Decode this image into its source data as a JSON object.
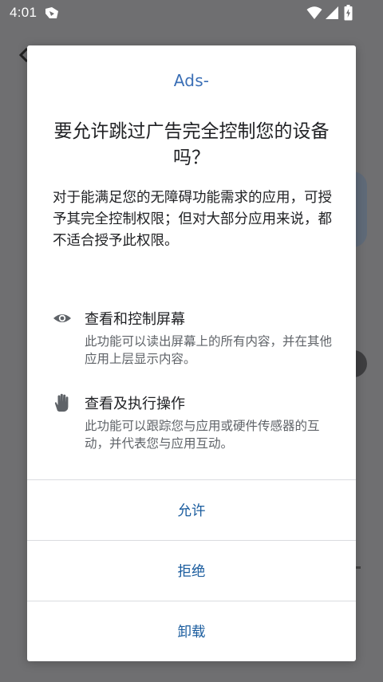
{
  "status_bar": {
    "time": "4:01"
  },
  "dialog": {
    "app_logo_text": "Ads-",
    "title": "要允许跳过广告完全控制您的设备吗？",
    "description": "对于能满足您的无障碍功能需求的应用，可授予其完全控制权限；但对大部分应用来说，都不适合授予此权限。",
    "permissions": [
      {
        "icon": "eye-icon",
        "title": "查看和控制屏幕",
        "subtitle": "此功能可以读出屏幕上的所有内容，并在其他应用上层显示内容。"
      },
      {
        "icon": "hand-icon",
        "title": "查看及执行操作",
        "subtitle": "此功能可以跟踪您与应用或硬件传感器的互动，并代表您与应用互动。"
      }
    ],
    "buttons": {
      "allow": "允许",
      "deny": "拒绝",
      "uninstall": "卸载"
    }
  },
  "colors": {
    "button_text": "#1a5c9e",
    "scrim": "#6f6f71",
    "logo_text": "#3b6fb6"
  }
}
